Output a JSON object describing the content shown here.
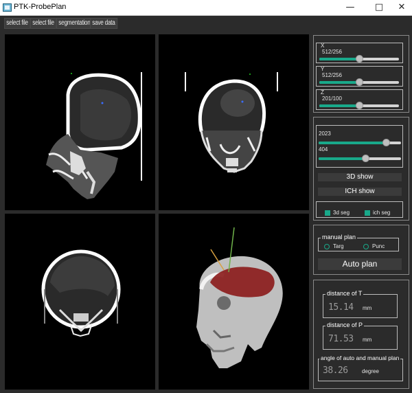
{
  "window": {
    "title": "PTK-ProbePlan",
    "minimize": "—",
    "maximize": "□",
    "close": "✕"
  },
  "menu": {
    "items": [
      "select file",
      "select file",
      "segmentation",
      "save data"
    ]
  },
  "sliders": {
    "x": {
      "label": "X",
      "value": "512/256",
      "fraction": 0.5
    },
    "y": {
      "label": "Y",
      "value": "512/256",
      "fraction": 0.5
    },
    "z": {
      "label": "Z",
      "value": "201/100",
      "fraction": 0.5
    },
    "window_width": {
      "value": "2023",
      "fraction": 0.82
    },
    "window_level": {
      "value": "404",
      "fraction": 0.57
    }
  },
  "buttons": {
    "show_3d": "3D show",
    "ich_show": "ICH show",
    "auto_plan": "Auto plan"
  },
  "checkboxes": {
    "seg_3d": "3d seg",
    "ich_seg": "ich seg"
  },
  "manual_plan": {
    "title": "manual plan",
    "targ": "Targ",
    "punc": "Punc"
  },
  "distances": {
    "t": {
      "label": "distance of T",
      "value": "15.14",
      "unit": "mm"
    },
    "p": {
      "label": "distance of P",
      "value": "71.53",
      "unit": "mm"
    },
    "angle": {
      "label": "angle of auto and manual plan",
      "value": "38.26",
      "unit": "degree"
    }
  },
  "colors": {
    "accent": "#19a98a",
    "background": "#2b2b2b",
    "hemorrhage": "#8b1a1a"
  }
}
